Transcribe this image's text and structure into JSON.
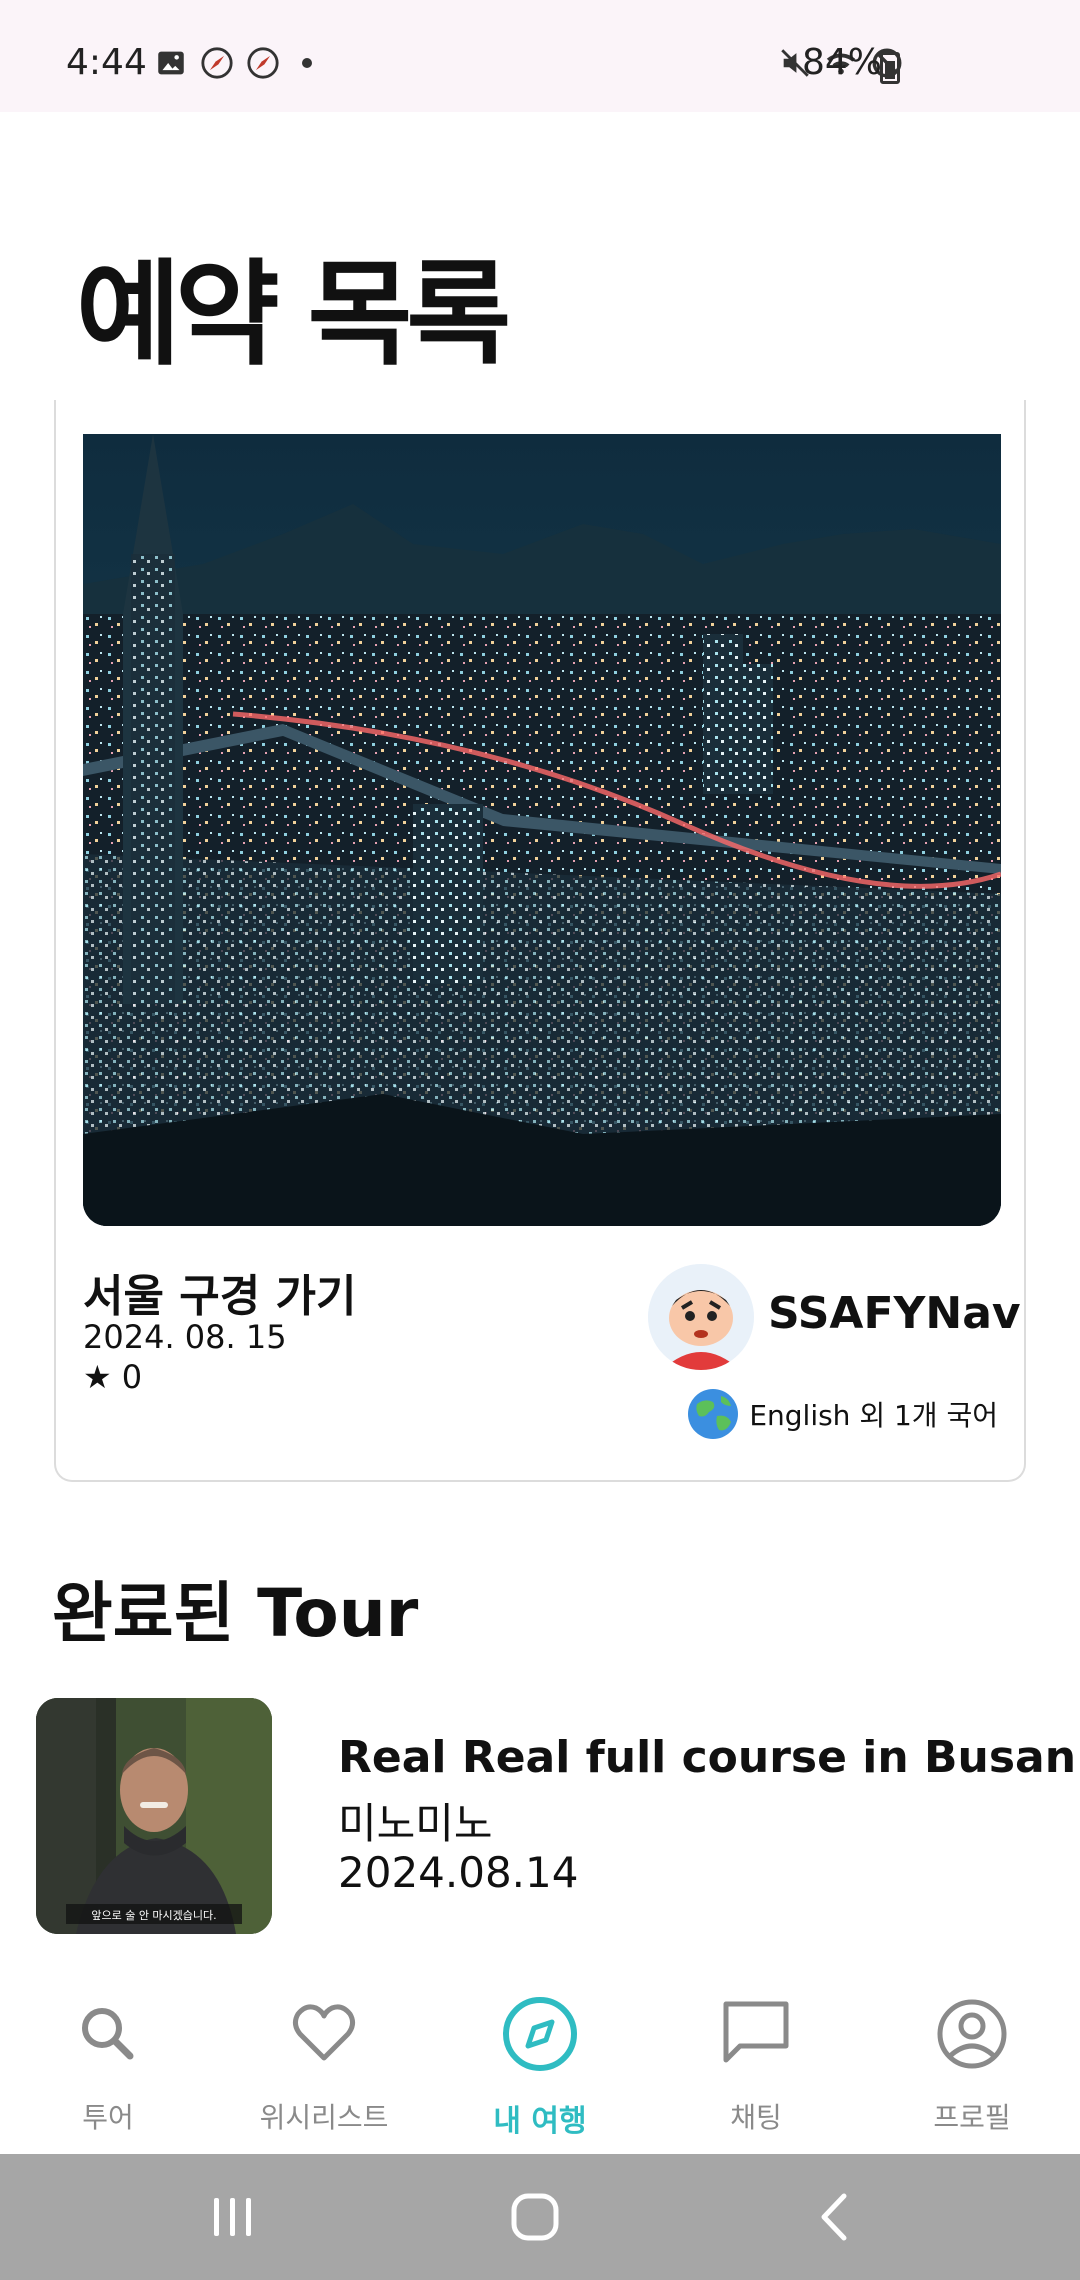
{
  "status_bar": {
    "time": "4:44",
    "battery_percent": "84%",
    "icons_left": [
      "gallery-icon",
      "compass-notification-icon",
      "compass-notification-icon",
      "dot-icon"
    ],
    "icons_right": [
      "mute-icon",
      "wifi-icon",
      "dnd-icon",
      "battery-icon"
    ]
  },
  "page": {
    "title": "예약 목록"
  },
  "reservation": {
    "title": "서울 구경 가기",
    "date": "2024. 08. 15",
    "rating_star": "★",
    "rating": "0",
    "guide_name": "SSAFYNav",
    "languages": "English 외 1개 국어"
  },
  "completed": {
    "section_title": "완료된 Tour",
    "items": [
      {
        "title": "Real Real full course in Busan",
        "guide": "미노미노",
        "date": "2024.08.14",
        "thumb_caption": "앞으로 술 안 마시겠습니다."
      }
    ]
  },
  "bottom_nav": {
    "items": [
      {
        "label": "투어",
        "icon": "search-icon",
        "active": false
      },
      {
        "label": "위시리스트",
        "icon": "heart-icon",
        "active": false
      },
      {
        "label": "내 여행",
        "icon": "compass-icon",
        "active": true
      },
      {
        "label": "채팅",
        "icon": "chat-icon",
        "active": false
      },
      {
        "label": "프로필",
        "icon": "profile-icon",
        "active": false
      }
    ]
  },
  "colors": {
    "accent": "#2fbcc2",
    "inactive": "#8a8a8a",
    "status_bar_bg": "#fbf4f9",
    "system_nav_bg": "#a6a6a6"
  }
}
